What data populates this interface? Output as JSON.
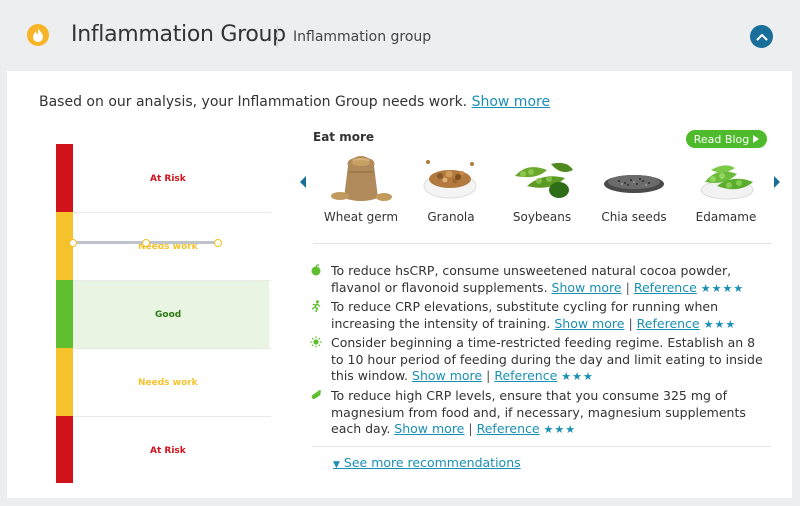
{
  "header": {
    "title": "Inflammation Group",
    "subtitle": "Inflammation group"
  },
  "summary": {
    "text": "Based on our analysis, your Inflammation Group needs work. ",
    "show_more": "Show more"
  },
  "gauge": {
    "zones": [
      {
        "label": "At Risk",
        "color": "#d0121b"
      },
      {
        "label": "Needs work",
        "color": "#f5c22b"
      },
      {
        "label": "Good",
        "color": "#5fbf2e"
      },
      {
        "label": "Needs work",
        "color": "#f5c22b"
      },
      {
        "label": "At Risk",
        "color": "#d0121b"
      }
    ],
    "current_zone": "Needs work"
  },
  "eat_more": {
    "title": "Eat more",
    "blog_button": "Read Blog",
    "foods": [
      "Wheat germ",
      "Granola",
      "Soybeans",
      "Chia seeds",
      "Edamame"
    ]
  },
  "recommendations": [
    {
      "text": "To reduce hsCRP, consume unsweetened natural cocoa powder, flavanol or flavonoid supplements.",
      "show_more": "Show more",
      "reference": "Reference",
      "stars": "★★★★"
    },
    {
      "text": "To reduce CRP elevations, substitute cycling for running when increasing the intensity of training.",
      "show_more": "Show more",
      "reference": "Reference",
      "stars": "★★★"
    },
    {
      "text": "Consider beginning a time-restricted feeding regime. Establish an 8 to 10 hour period of feeding during the day and limit eating to inside this window.",
      "show_more": "Show more",
      "reference": "Reference",
      "stars": "★★★"
    },
    {
      "text": "To reduce high CRP levels, ensure that you consume 325 mg of magnesium from food and, if necessary, magnesium supplements each day.",
      "show_more": "Show more",
      "reference": "Reference",
      "stars": "★★★"
    }
  ],
  "see_more": "See more recommendations",
  "colors": {
    "accent": "#1a8fb4",
    "brand_dark": "#1a6f9a",
    "good": "#5fbf2e",
    "needs_work": "#f5c22b",
    "at_risk": "#d0121b"
  }
}
